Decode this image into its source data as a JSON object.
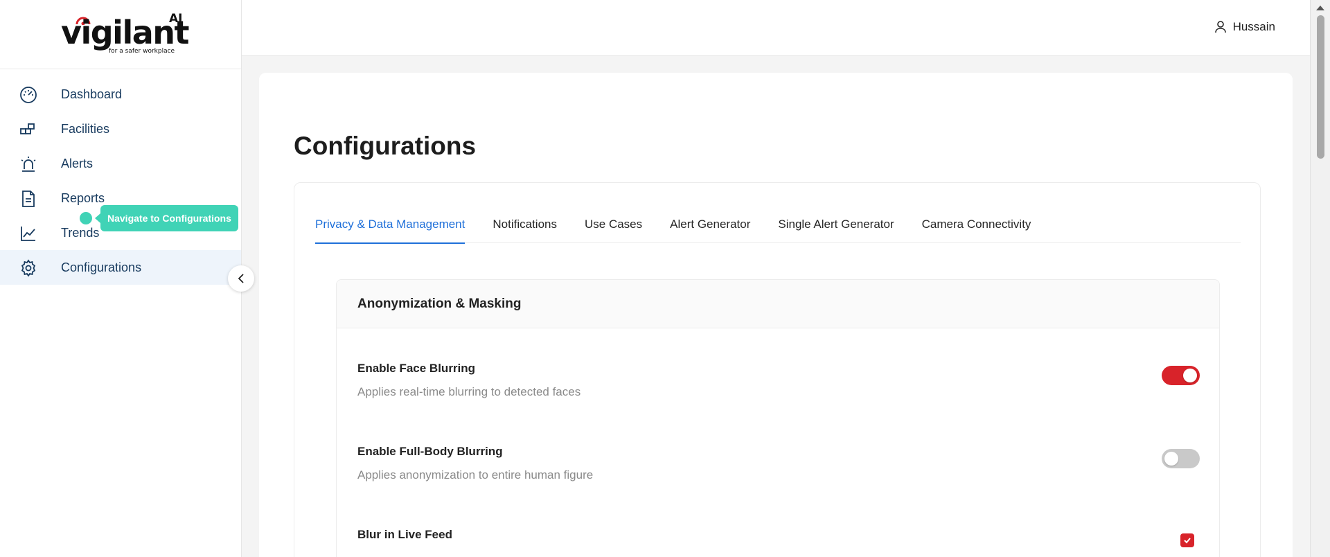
{
  "app": {
    "logo_word": "vigilant",
    "logo_superscript": "AI",
    "logo_tagline": "for a safer workplace"
  },
  "sidebar": {
    "items": [
      {
        "label": "Dashboard",
        "icon": "gauge-icon"
      },
      {
        "label": "Facilities",
        "icon": "blocks-icon"
      },
      {
        "label": "Alerts",
        "icon": "siren-icon"
      },
      {
        "label": "Reports",
        "icon": "document-icon"
      },
      {
        "label": "Trends",
        "icon": "line-chart-icon"
      },
      {
        "label": "Configurations",
        "icon": "gear-icon",
        "active": true
      }
    ],
    "tooltip": "Navigate to Configurations"
  },
  "header": {
    "user_name": "Hussain"
  },
  "main": {
    "page_title": "Configurations",
    "tabs": [
      {
        "label": "Privacy & Data Management",
        "active": true
      },
      {
        "label": "Notifications"
      },
      {
        "label": "Use Cases"
      },
      {
        "label": "Alert Generator"
      },
      {
        "label": "Single Alert Generator"
      },
      {
        "label": "Camera Connectivity"
      }
    ],
    "section": {
      "title": "Anonymization & Masking",
      "settings": [
        {
          "title": "Enable Face Blurring",
          "description": "Applies real-time blurring to detected faces",
          "control": "toggle",
          "enabled": true
        },
        {
          "title": "Enable Full-Body Blurring",
          "description": "Applies anonymization to entire human figure",
          "control": "toggle",
          "enabled": false
        },
        {
          "title": "Blur in Live Feed",
          "control": "checkbox",
          "checked": true
        }
      ]
    }
  },
  "colors": {
    "accent_blue": "#1e6fd9",
    "toggle_on": "#d8232a",
    "tooltip": "#40d3b6",
    "nav_text": "#173a5e"
  }
}
